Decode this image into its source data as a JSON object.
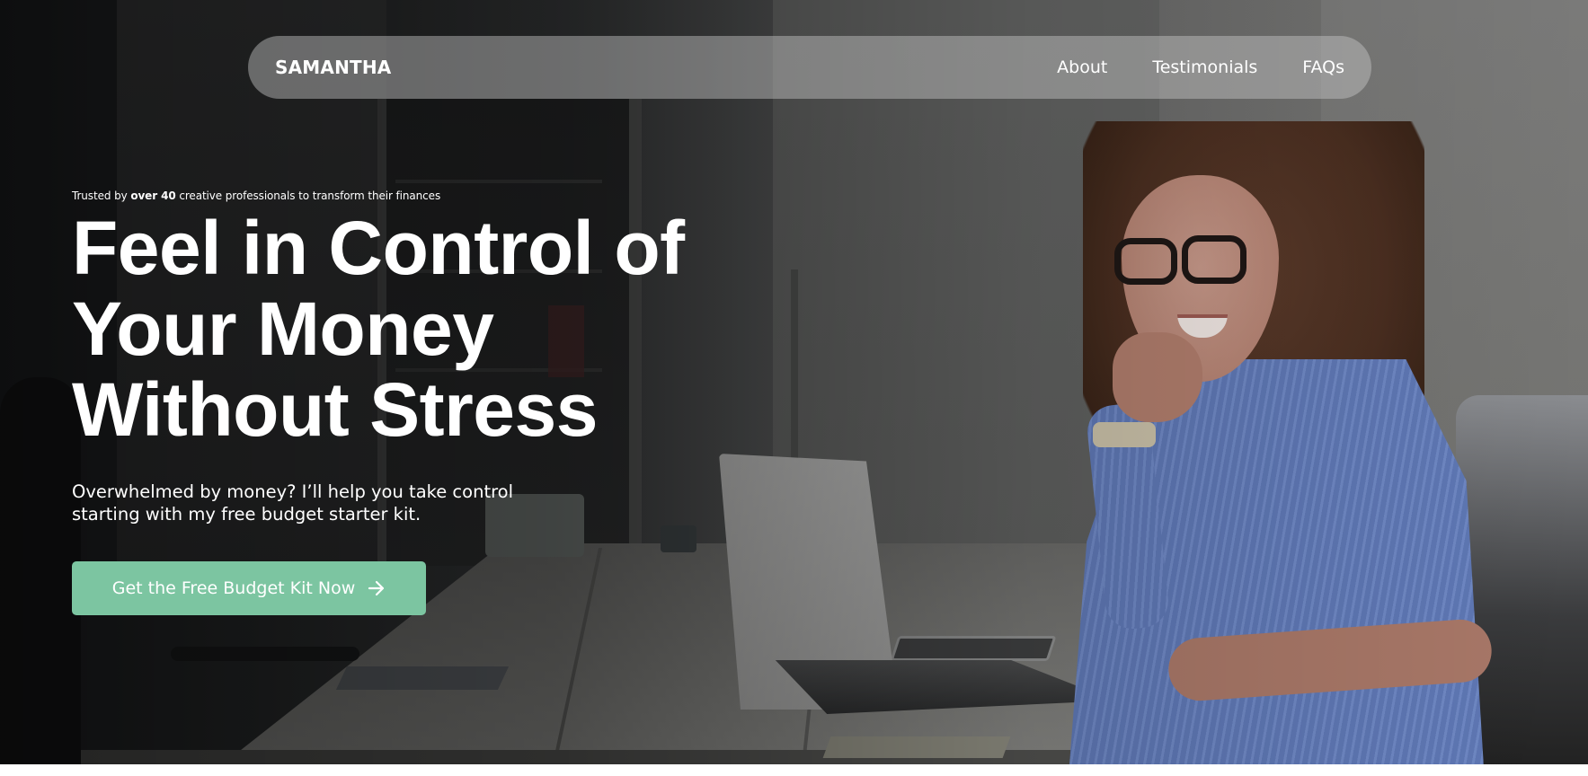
{
  "nav": {
    "brand": "SAMANTHA",
    "links": [
      {
        "label": "About"
      },
      {
        "label": "Testimonials"
      },
      {
        "label": "FAQs"
      }
    ]
  },
  "hero": {
    "trusted_prefix": "Trusted by ",
    "trusted_bold": "over 40",
    "trusted_suffix": " creative professionals to transform their finances",
    "headline_lines": [
      "Feel in Control of",
      "Your Money",
      "Without Stress"
    ],
    "subtitle_lines": [
      "Overwhelmed by money? I’ll help you take control",
      "starting with my free budget starter kit."
    ],
    "cta_label": "Get the Free Budget Kit Now",
    "cta_icon": "arrow-right-icon",
    "background_image": "woman-at-desk-with-laptop-photo"
  },
  "colors": {
    "cta_background": "#7cc5a1",
    "text": "#ffffff",
    "navbar_background": "rgba(200,200,200,0.45)"
  }
}
